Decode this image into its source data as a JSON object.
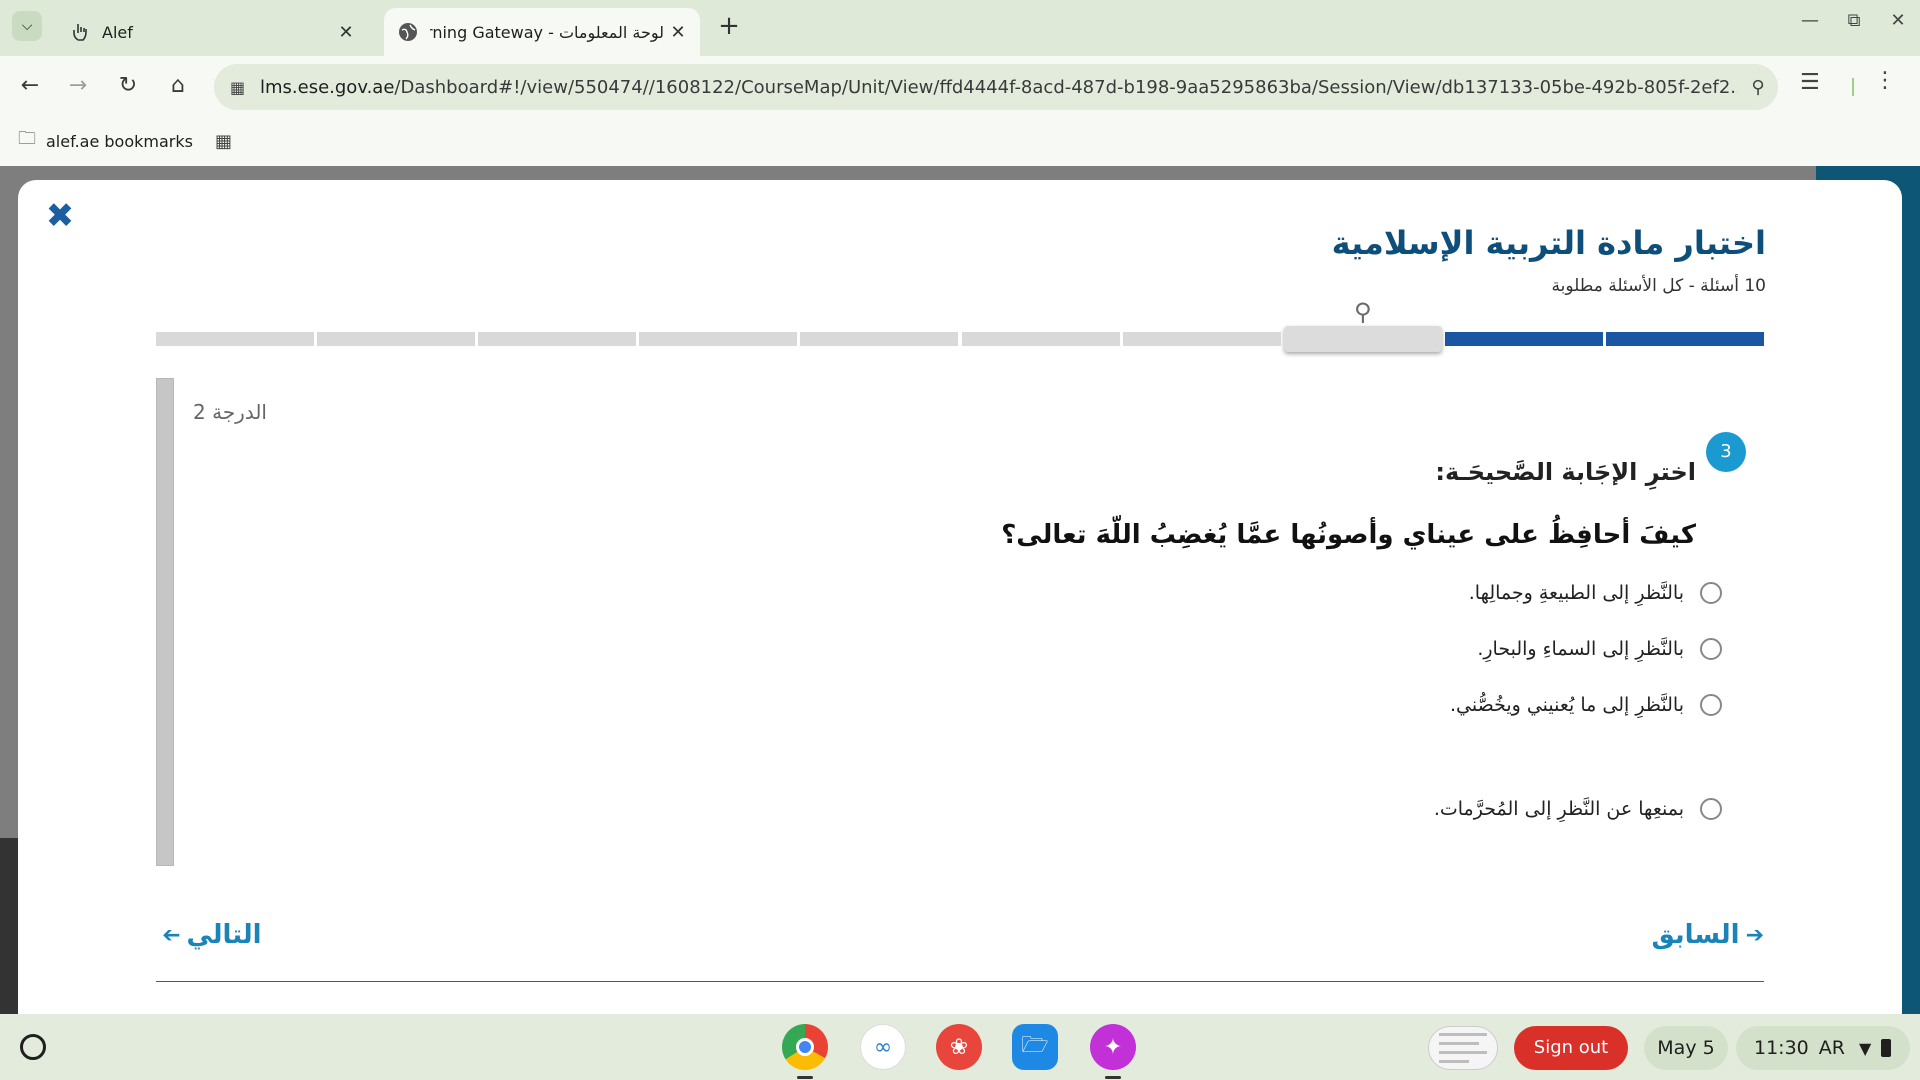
{
  "browser": {
    "tabs": [
      {
        "title": "Alef",
        "icon": "hand-icon"
      },
      {
        "title": "لوحة المعلومات - Learning Gateway",
        "icon": "globe-icon"
      }
    ],
    "url_host": "lms.ese.gov.ae",
    "url_path": "/Dashboard#!/view/550474//1608122/CourseMap/Unit/View/ffd4444f-8acd-487d-b198-9aa5295863ba/Session/View/db137133-05be-492b-805f-2ef2...",
    "bookmarks_label": "alef.ae bookmarks"
  },
  "quiz": {
    "title": "اختبار مادة التربية الإسلامية",
    "subtitle": "10 أسئلة - كل الأسئلة مطلوبة",
    "progress": {
      "total": 10,
      "completed": 2,
      "current": 3
    },
    "score_label": "الدرجة 2",
    "question_number": "3",
    "instruction": "اخترِ الإجَابة الصَّحيحَـة:",
    "question": "كيفَ أحافِظُ على عيناي وأصونُها عمَّا يُغضِبُ اللّهَ تعالى؟",
    "options": [
      "بالنَّظرِ إلى الطبيعةِ وجمالِها.",
      "بالنَّظرِ إلى السماءِ والبحارِ.",
      "بالنَّظرِ إلى ما يُعنيني ويخُصُّني.",
      "بمنعِها عن النَّظرِ إلى المُحرَّمات."
    ],
    "prev_label": "السابق",
    "next_label": "التالي"
  },
  "shelf": {
    "apps": [
      "chrome-icon",
      "link-app-icon",
      "paint-app-icon",
      "files-icon",
      "sparkle-app-icon"
    ],
    "sign_out": "Sign out",
    "date": "May 5",
    "time": "11:30",
    "ime": "AR"
  },
  "colors": {
    "accent": "#1a56a3",
    "title": "#0d4f7a",
    "badge": "#1a9ad0",
    "sign_out": "#d9302a"
  }
}
